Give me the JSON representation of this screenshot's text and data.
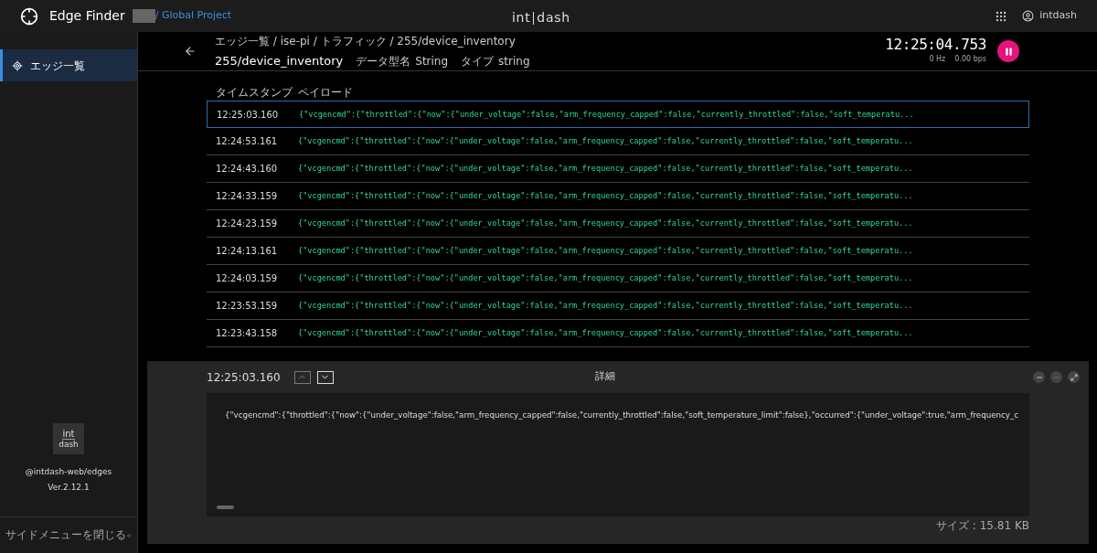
{
  "app": {
    "title": "Edge Finder",
    "project": "/ Global Project",
    "logo": {
      "left": "int",
      "right": "dash"
    },
    "user": "intdash"
  },
  "sidebar": {
    "items": [
      {
        "label": "エッジ一覧",
        "selected": true
      }
    ],
    "logo": {
      "top": "int",
      "bottom": "dash"
    },
    "package": "@intdash-web/edges",
    "version": "Ver.2.12.1",
    "close_label": "サイドメニューを閉じる"
  },
  "header": {
    "breadcrumb": "エッジ一覧 / ise-pi / トラフィック / 255/device_inventory",
    "title": "255/device_inventory",
    "meta": [
      {
        "label": "データ型名",
        "value": "String"
      },
      {
        "label": "タイプ",
        "value": "string"
      }
    ],
    "clock": "12:25:04.753",
    "rate": "0 Hz",
    "bandwidth": "0.00 bps",
    "playing": true
  },
  "table": {
    "columns": [
      "タイムスタンプ",
      "ペイロード"
    ],
    "rows": [
      {
        "time": "12:25:03.160",
        "payload": "{\"vcgencmd\":{\"throttled\":{\"now\":{\"under_voltage\":false,\"arm_frequency_capped\":false,\"currently_throttled\":false,\"soft_temperatu...",
        "selected": true
      },
      {
        "time": "12:24:53.161",
        "payload": "{\"vcgencmd\":{\"throttled\":{\"now\":{\"under_voltage\":false,\"arm_frequency_capped\":false,\"currently_throttled\":false,\"soft_temperatu...",
        "selected": false
      },
      {
        "time": "12:24:43.160",
        "payload": "{\"vcgencmd\":{\"throttled\":{\"now\":{\"under_voltage\":false,\"arm_frequency_capped\":false,\"currently_throttled\":false,\"soft_temperatu...",
        "selected": false
      },
      {
        "time": "12:24:33.159",
        "payload": "{\"vcgencmd\":{\"throttled\":{\"now\":{\"under_voltage\":false,\"arm_frequency_capped\":false,\"currently_throttled\":false,\"soft_temperatu...",
        "selected": false
      },
      {
        "time": "12:24:23.159",
        "payload": "{\"vcgencmd\":{\"throttled\":{\"now\":{\"under_voltage\":false,\"arm_frequency_capped\":false,\"currently_throttled\":false,\"soft_temperatu...",
        "selected": false
      },
      {
        "time": "12:24:13.161",
        "payload": "{\"vcgencmd\":{\"throttled\":{\"now\":{\"under_voltage\":false,\"arm_frequency_capped\":false,\"currently_throttled\":false,\"soft_temperatu...",
        "selected": false
      },
      {
        "time": "12:24:03.159",
        "payload": "{\"vcgencmd\":{\"throttled\":{\"now\":{\"under_voltage\":false,\"arm_frequency_capped\":false,\"currently_throttled\":false,\"soft_temperatu...",
        "selected": false
      },
      {
        "time": "12:23:53.159",
        "payload": "{\"vcgencmd\":{\"throttled\":{\"now\":{\"under_voltage\":false,\"arm_frequency_capped\":false,\"currently_throttled\":false,\"soft_temperatu...",
        "selected": false
      },
      {
        "time": "12:23:43.158",
        "payload": "{\"vcgencmd\":{\"throttled\":{\"now\":{\"under_voltage\":false,\"arm_frequency_capped\":false,\"currently_throttled\":false,\"soft_temperatu...",
        "selected": false
      }
    ]
  },
  "detail": {
    "time": "12:25:03.160",
    "title": "詳細",
    "content": "{\"vcgencmd\":{\"throttled\":{\"now\":{\"under_voltage\":false,\"arm_frequency_capped\":false,\"currently_throttled\":false,\"soft_temperature_limit\":false},\"occurred\":{\"under_voltage\":true,\"arm_frequency_c",
    "size": "サイズ : 15.81 KB"
  }
}
